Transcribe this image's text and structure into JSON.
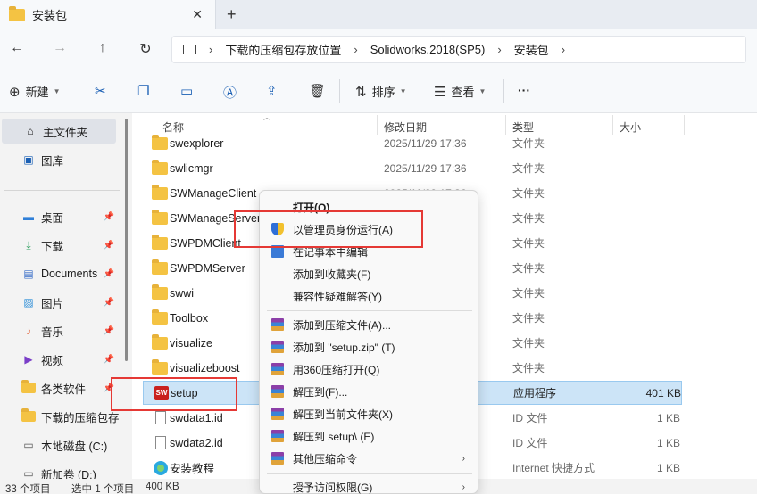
{
  "window": {
    "tab_title": "安装包",
    "close_glyph": "✕",
    "new_tab_glyph": "+"
  },
  "nav": {
    "back_glyph": "←",
    "forward_glyph": "→",
    "up_glyph": "↑",
    "refresh_glyph": "↻",
    "more_glyph": "›",
    "breadcrumb": [
      "下载的压缩包存放位置",
      "Solidworks.2018(SP5)",
      "安装包"
    ]
  },
  "toolbar": {
    "new_label": "新建",
    "sort_label": "排序",
    "view_label": "查看",
    "more_glyph": "···"
  },
  "sidebar": {
    "items": [
      {
        "label": "主文件夹",
        "icon": "home-icon",
        "glyph": "⌂"
      },
      {
        "label": "图库",
        "icon": "gallery-icon",
        "glyph": "▣"
      },
      {
        "label": "桌面",
        "icon": "desktop-icon",
        "glyph": "▬"
      },
      {
        "label": "下载",
        "icon": "download-icon",
        "glyph": "⤓"
      },
      {
        "label": "Documents",
        "icon": "documents-icon",
        "glyph": "▤"
      },
      {
        "label": "图片",
        "icon": "pictures-icon",
        "glyph": "▨"
      },
      {
        "label": "音乐",
        "icon": "music-icon",
        "glyph": "♪"
      },
      {
        "label": "视频",
        "icon": "video-icon",
        "glyph": "▶"
      },
      {
        "label": "各类软件",
        "icon": "folder-icon",
        "glyph": ""
      },
      {
        "label": "下载的压缩包存",
        "icon": "folder-icon",
        "glyph": ""
      },
      {
        "label": "本地磁盘 (C:)",
        "icon": "drive-icon",
        "glyph": "▭"
      },
      {
        "label": "新加卷 (D:)",
        "icon": "drive-icon",
        "glyph": "▭"
      }
    ]
  },
  "columns": {
    "name": "名称",
    "date": "修改日期",
    "type": "类型",
    "size": "大小"
  },
  "files": [
    {
      "name": "swexplorer",
      "date": "2025/11/29 17:36",
      "type": "文件夹",
      "size": ""
    },
    {
      "name": "swlicmgr",
      "date": "2025/11/29 17:36",
      "type": "文件夹",
      "size": ""
    },
    {
      "name": "SWManageClient",
      "date": "2025/11/29 17:36",
      "type": "文件夹",
      "size": ""
    },
    {
      "name": "SWManageServer",
      "date": "",
      "type": "文件夹",
      "size": ""
    },
    {
      "name": "SWPDMClient",
      "date": "",
      "type": "文件夹",
      "size": ""
    },
    {
      "name": "SWPDMServer",
      "date": "",
      "type": "文件夹",
      "size": ""
    },
    {
      "name": "swwi",
      "date": "",
      "type": "文件夹",
      "size": ""
    },
    {
      "name": "Toolbox",
      "date": "",
      "type": "文件夹",
      "size": ""
    },
    {
      "name": "visualize",
      "date": "",
      "type": "文件夹",
      "size": ""
    },
    {
      "name": "visualizeboost",
      "date": "",
      "type": "文件夹",
      "size": ""
    },
    {
      "name": "setup",
      "date": "",
      "type": "应用程序",
      "size": "401 KB"
    },
    {
      "name": "swdata1.id",
      "date": "",
      "type": "ID 文件",
      "size": "1 KB"
    },
    {
      "name": "swdata2.id",
      "date": "",
      "type": "ID 文件",
      "size": "1 KB"
    },
    {
      "name": "安装教程",
      "date": "",
      "type": "Internet 快捷方式",
      "size": "1 KB"
    }
  ],
  "status": {
    "count": "33 个项目",
    "selected": "选中 1 个项目",
    "size": "400 KB"
  },
  "context_menu": {
    "items": [
      {
        "label": "打开(O)"
      },
      {
        "label": "以管理员身份运行(A)"
      },
      {
        "label": "在记事本中编辑"
      },
      {
        "label": "添加到收藏夹(F)"
      },
      {
        "label": "兼容性疑难解答(Y)"
      },
      {
        "label": "添加到压缩文件(A)..."
      },
      {
        "label": "添加到 \"setup.zip\" (T)"
      },
      {
        "label": "用360压缩打开(Q)"
      },
      {
        "label": "解压到(F)..."
      },
      {
        "label": "解压到当前文件夹(X)"
      },
      {
        "label": "解压到 setup\\ (E)"
      },
      {
        "label": "其他压缩命令"
      },
      {
        "label": "授予访问权限(G)"
      }
    ],
    "arrow_glyph": "›"
  },
  "colors": {
    "accent": "#1a5fb4",
    "selection": "#cce4f7",
    "annotation": "#e53935"
  }
}
